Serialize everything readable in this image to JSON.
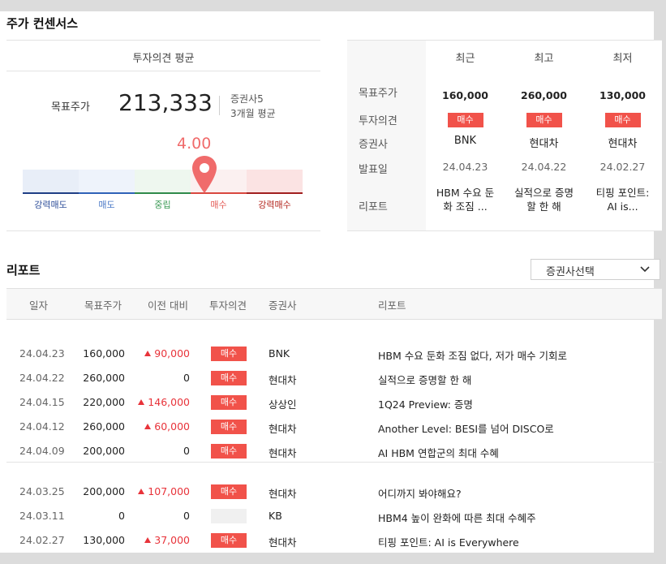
{
  "consensus": {
    "title": "주가 컨센서스",
    "avg_header": "투자의견 평균",
    "target_label": "목표주가",
    "target_value": "213,333",
    "brokers_text": "증권사5",
    "period_text": "3개월 평균",
    "score": "4.00",
    "score_fraction": 0.75,
    "gauge_labels": [
      "강력매도",
      "매도",
      "중립",
      "매수",
      "강력매수"
    ],
    "gauge_label_colors": [
      "#2f4f9a",
      "#4a78c6",
      "#3c9a56",
      "#e35a55",
      "#b3261e"
    ],
    "gauge_segment_colors": [
      "#e8eef8",
      "#eef3fb",
      "#eef7ef",
      "#fbf0f0",
      "#fbe3e3"
    ],
    "gauge_line_colors": [
      "#1f3f86",
      "#2f62b8",
      "#2f8a4a",
      "#d9473f",
      "#a11f1f"
    ]
  },
  "compare": {
    "columns": [
      "최근",
      "최고",
      "최저"
    ],
    "row_labels": [
      "목표주가",
      "투자의견",
      "증권사",
      "발표일",
      "리포트"
    ],
    "rows": [
      {
        "target": "160,000",
        "opinion": "매수",
        "broker": "BNK",
        "date": "24.04.23",
        "report": "HBM 수요 둔화 조짐 ..."
      },
      {
        "target": "260,000",
        "opinion": "매수",
        "broker": "현대차",
        "date": "24.04.22",
        "report": "실적으로 증명할 한 해"
      },
      {
        "target": "130,000",
        "opinion": "매수",
        "broker": "현대차",
        "date": "24.02.27",
        "report": "티핑 포인트: AI is..."
      }
    ]
  },
  "reports": {
    "title": "리포트",
    "select_label": "증권사선택",
    "headers": [
      "일자",
      "목표주가",
      "이전 대비",
      "투자의견",
      "증권사",
      "리포트"
    ],
    "group1": [
      {
        "date": "24.04.23",
        "target": "160,000",
        "change": "90,000",
        "up": true,
        "opinion": "매수",
        "broker": "BNK",
        "title": "HBM 수요 둔화 조짐 없다, 저가 매수 기회로"
      },
      {
        "date": "24.04.22",
        "target": "260,000",
        "change": "0",
        "up": false,
        "opinion": "매수",
        "broker": "현대차",
        "title": "실적으로 증명할 한 해"
      },
      {
        "date": "24.04.15",
        "target": "220,000",
        "change": "146,000",
        "up": true,
        "opinion": "매수",
        "broker": "상상인",
        "title": "1Q24 Preview: 증명"
      },
      {
        "date": "24.04.12",
        "target": "260,000",
        "change": "60,000",
        "up": true,
        "opinion": "매수",
        "broker": "현대차",
        "title": "Another Level: BESI를 넘어 DISCO로"
      },
      {
        "date": "24.04.09",
        "target": "200,000",
        "change": "0",
        "up": false,
        "opinion": "매수",
        "broker": "현대차",
        "title": "AI HBM 연합군의 최대 수혜"
      }
    ],
    "group2": [
      {
        "date": "24.03.25",
        "target": "200,000",
        "change": "107,000",
        "up": true,
        "opinion": "매수",
        "broker": "현대차",
        "title": "어디까지 봐야해요?"
      },
      {
        "date": "24.03.11",
        "target": "0",
        "change": "0",
        "up": false,
        "opinion": "",
        "broker": "KB",
        "title": "HBM4 높이 완화에 따른 최대 수혜주"
      },
      {
        "date": "24.02.27",
        "target": "130,000",
        "change": "37,000",
        "up": true,
        "opinion": "매수",
        "broker": "현대차",
        "title": "티핑 포인트: AI is Everywhere"
      }
    ]
  }
}
